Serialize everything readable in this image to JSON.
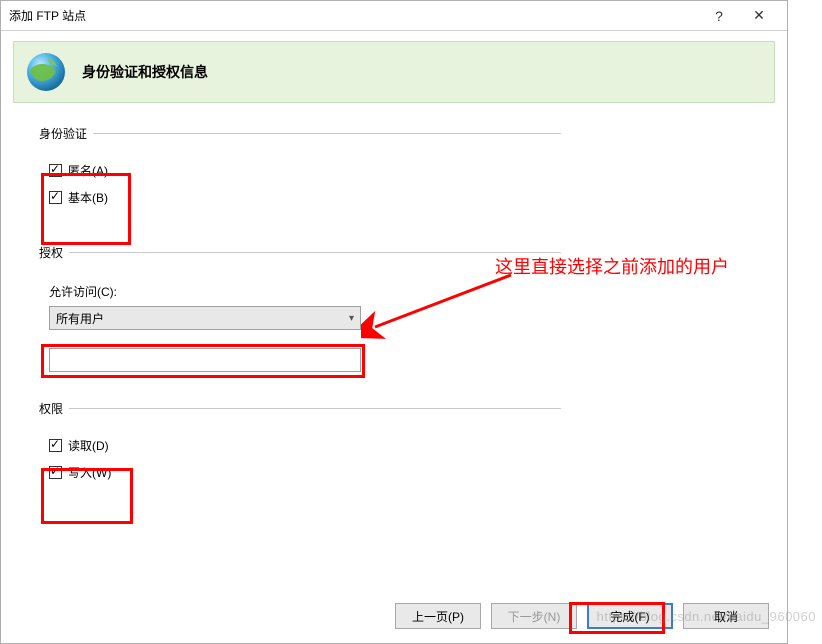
{
  "window": {
    "title": "添加 FTP 站点",
    "help": "?",
    "close": "✕"
  },
  "header": {
    "title": "身份验证和授权信息"
  },
  "auth": {
    "legend": "身份验证",
    "anonymous": "匿名(A)",
    "basic": "基本(B)"
  },
  "authorization": {
    "legend": "授权",
    "allow_label": "允许访问(C):",
    "selected": "所有用户"
  },
  "permissions": {
    "legend": "权限",
    "read": "读取(D)",
    "write": "写入(W)"
  },
  "buttons": {
    "prev": "上一页(P)",
    "next": "下一步(N)",
    "finish": "完成(F)",
    "cancel": "取消"
  },
  "annotation": {
    "text": "这里直接选择之前添加的用户"
  },
  "watermark": "https://blog.csdn.net/baidu_960060"
}
